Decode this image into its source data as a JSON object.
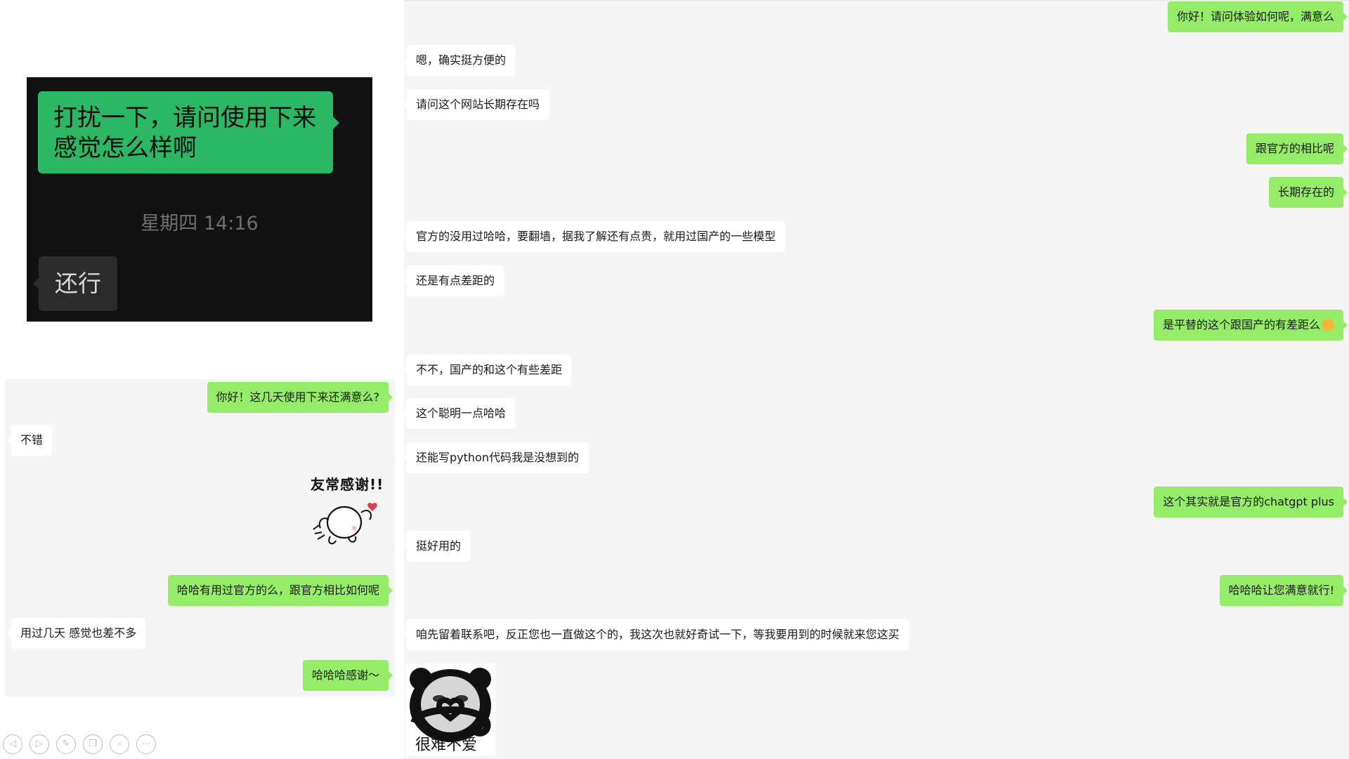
{
  "dark_chat": {
    "bubble_text": "打扰一下，请问使用下来感觉怎么样啊",
    "timestamp": "星期四 14:16",
    "reply_text": "还行"
  },
  "left_chat": {
    "messages": [
      {
        "side": "out",
        "text": "你好！这几天使用下来还满意么?"
      },
      {
        "side": "in",
        "text": "不错"
      },
      {
        "side": "out",
        "text": "哈哈有用过官方的么，跟官方相比如何呢"
      },
      {
        "side": "in",
        "text": "用过几天 感觉也差不多"
      },
      {
        "side": "out",
        "text": "哈哈哈感谢～"
      }
    ],
    "sticker_text": "友常感谢!!"
  },
  "right_chat": {
    "messages": [
      {
        "side": "out",
        "text": "你好！请问体验如何呢，满意么"
      },
      {
        "side": "in",
        "text": "嗯，确实挺方便的"
      },
      {
        "side": "in",
        "text": "请问这个网站长期存在吗"
      },
      {
        "side": "out",
        "text": "跟官方的相比呢"
      },
      {
        "side": "out",
        "text": "长期存在的"
      },
      {
        "side": "in",
        "text": "官方的没用过哈哈，要翻墙，据我了解还有点贵，就用过国产的一些模型"
      },
      {
        "side": "in",
        "text": "还是有点差距的"
      },
      {
        "side": "out",
        "text": "是平替的这个跟国产的有差距么"
      },
      {
        "side": "in",
        "text": "不不，国产的和这个有些差距"
      },
      {
        "side": "in",
        "text": "这个聪明一点哈哈"
      },
      {
        "side": "in",
        "text": "还能写python代码我是没想到的"
      },
      {
        "side": "out",
        "text": "这个其实就是官方的chatgpt plus"
      },
      {
        "side": "in",
        "text": "挺好用的"
      },
      {
        "side": "out",
        "text": "哈哈哈让您满意就行!"
      },
      {
        "side": "in",
        "text": "咱先留着联系吧，反正您也一直做这个的，我这次也就好奇试一下，等我要用到的时候就来您这买"
      }
    ],
    "panda_sticker_text": "很难不爱",
    "emoji_icon": "laughing-face-icon"
  },
  "toolbar": {
    "icons": [
      "prev-icon",
      "next-icon",
      "pen-icon",
      "copy-icon",
      "zoom-icon",
      "more-icon"
    ]
  },
  "colors": {
    "outgoing_bubble": "#95ec69",
    "incoming_bubble": "#ffffff",
    "chat_background": "#f5f5f5",
    "dark_bubble": "#2cb764",
    "dark_background": "#111111"
  }
}
